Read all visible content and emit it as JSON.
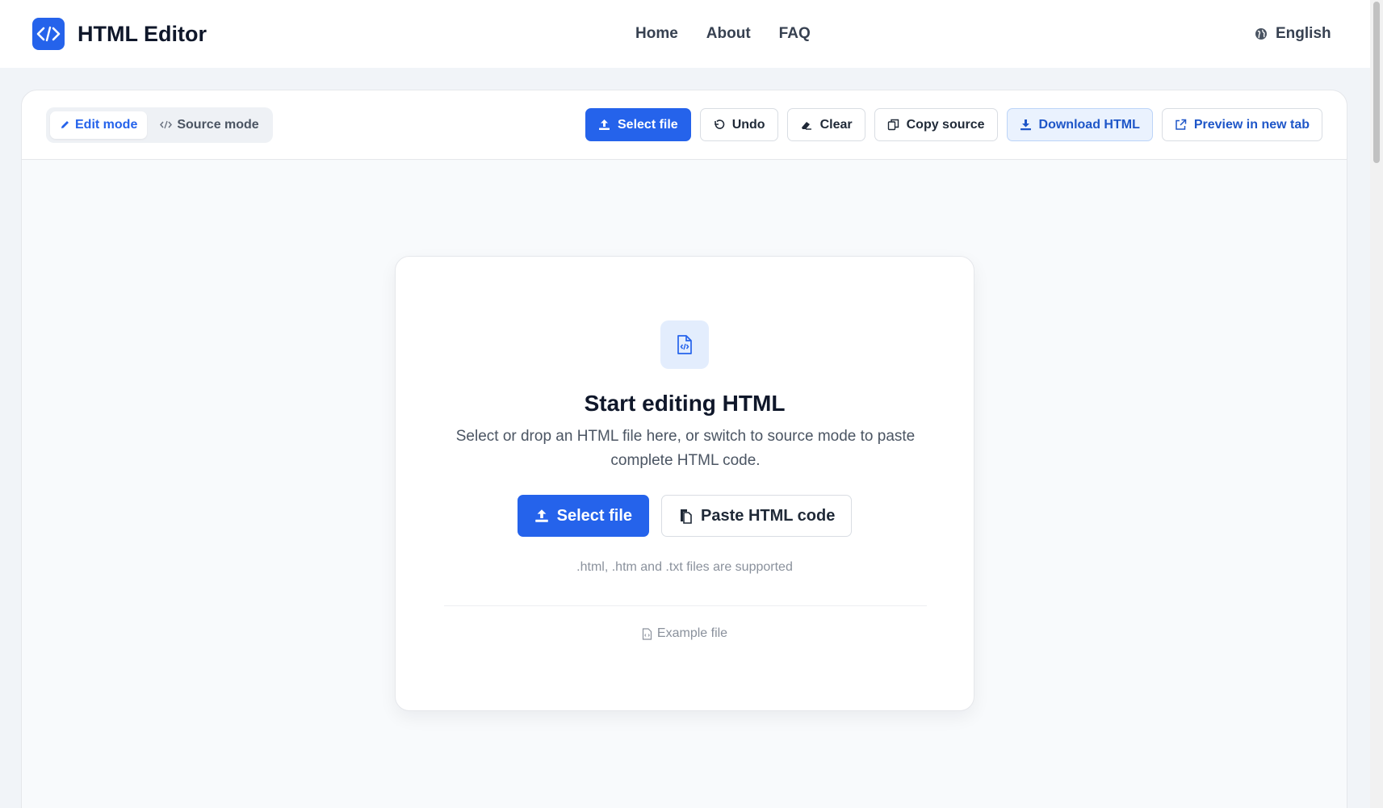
{
  "header": {
    "app_title": "HTML Editor",
    "logo_icon": "code-icon",
    "nav": [
      {
        "label": "Home"
      },
      {
        "label": "About"
      },
      {
        "label": "FAQ"
      }
    ],
    "language": {
      "label": "English",
      "icon": "globe-icon"
    }
  },
  "toolbar": {
    "modes": [
      {
        "label": "Edit mode",
        "icon": "pencil-icon",
        "active": true
      },
      {
        "label": "Source mode",
        "icon": "code-icon",
        "active": false
      }
    ],
    "actions": [
      {
        "label": "Select file",
        "icon": "upload-icon"
      },
      {
        "label": "Undo",
        "icon": "undo-icon"
      },
      {
        "label": "Clear",
        "icon": "eraser-icon"
      },
      {
        "label": "Copy source",
        "icon": "copy-icon"
      },
      {
        "label": "Download HTML",
        "icon": "download-icon"
      },
      {
        "label": "Preview in new tab",
        "icon": "external-link-icon"
      }
    ]
  },
  "dropzone": {
    "icon": "file-code-icon",
    "title": "Start editing HTML",
    "description": "Select or drop an HTML file here, or switch to source mode to paste complete HTML code.",
    "select_label": "Select file",
    "paste_label": "Paste HTML code",
    "hint": ".html, .htm and .txt files are supported",
    "example_label": "Example file"
  },
  "colors": {
    "primary": "#2563eb",
    "page_bg": "#f1f4f8",
    "soft_blue": "#eaf2fe"
  }
}
